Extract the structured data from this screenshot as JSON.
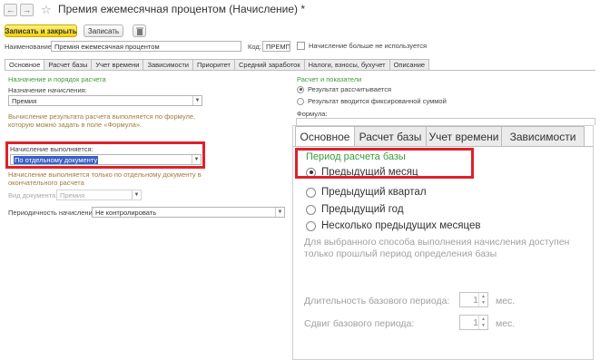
{
  "window": {
    "title": "Премия ежемесячная процентом (Начисление) *"
  },
  "toolbar": {
    "save_close_label": "Записать и закрыть",
    "save_label": "Записать"
  },
  "header": {
    "name_label": "Наименование:",
    "name_value": "Премия ежемесячная процентом",
    "code_label": "Код:",
    "code_value": "ПРЕМП",
    "unused_label": "Начисление больше не используется"
  },
  "tabs": [
    {
      "label": "Основное"
    },
    {
      "label": "Расчет базы"
    },
    {
      "label": "Учет времени"
    },
    {
      "label": "Зависимости"
    },
    {
      "label": "Приоритет"
    },
    {
      "label": "Средний заработок"
    },
    {
      "label": "Налоги, взносы, бухучет"
    },
    {
      "label": "Описание"
    }
  ],
  "left": {
    "section_title": "Назначение и порядок расчета",
    "purpose_label": "Назначение начисления:",
    "purpose_value": "Премия",
    "purpose_hint": "Вычисление результата расчета выполняется по формуле, которую можно задать в поле «Формула».",
    "performed_label": "Начисление выполняется:",
    "performed_value": "По отдельному документу",
    "performed_hint": "Начисление выполняется только по отдельному документу в окончательного расчета",
    "doc_type_label": "Вид документа:",
    "doc_type_value": "Премия",
    "periodicity_label": "Периодичность начисления:",
    "periodicity_value": "Не контролировать"
  },
  "right": {
    "section_title": "Расчет и показатели",
    "radio_calc": "Результат рассчитывается",
    "radio_fixed": "Результат вводится фиксированной суммой",
    "formula_label": "Формула:"
  },
  "zoom_panel": {
    "tabs": [
      {
        "label": "Основное"
      },
      {
        "label": "Расчет базы"
      },
      {
        "label": "Учет времени"
      },
      {
        "label": "Зависимости"
      }
    ],
    "period_title": "Период расчета базы",
    "options": [
      {
        "label": "Предыдущий месяц",
        "selected": true
      },
      {
        "label": "Предыдущий квартал",
        "selected": false
      },
      {
        "label": "Предыдущий год",
        "selected": false
      },
      {
        "label": "Несколько предыдущих месяцев",
        "selected": false
      }
    ],
    "note": "Для выбранного способа выполнения начисления доступен только прошлый период определения базы",
    "duration_label": "Длительность базового периода:",
    "duration_value": "1",
    "duration_unit": "мес.",
    "shift_label": "Сдвиг базового периода:",
    "shift_value": "1",
    "shift_unit": "мес."
  },
  "colors": {
    "highlight_red": "#e0202a",
    "accent_green": "#3d9a3d",
    "primary_yellow": "#f5d300",
    "selection_blue": "#3b5fc8"
  },
  "icons": {
    "back": "arrow-left-icon",
    "forward": "arrow-right-icon",
    "favorite": "star-icon",
    "delete": "trash-icon",
    "dropdown": "chevron-down-icon"
  }
}
